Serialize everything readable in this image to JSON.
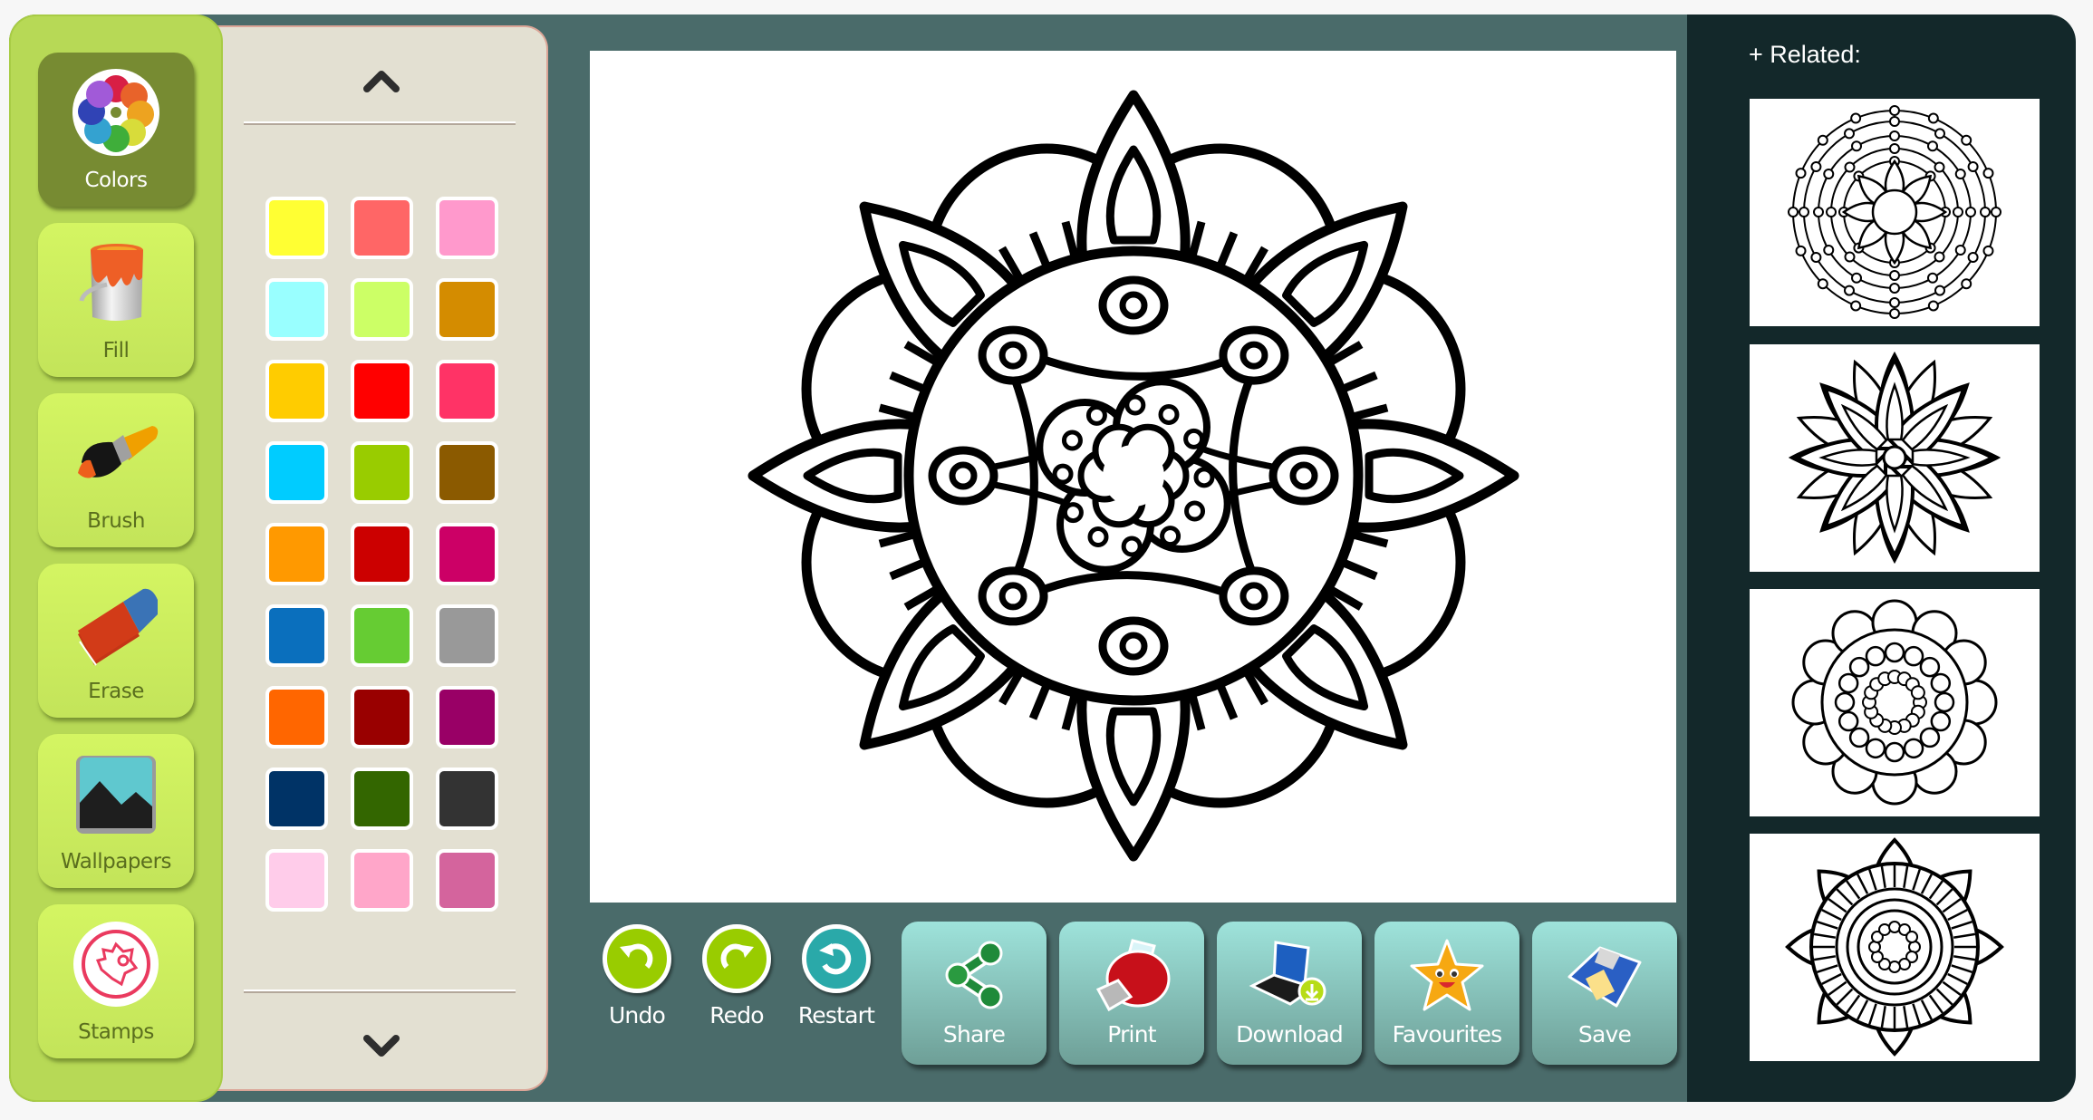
{
  "sidebar": {
    "tools": [
      {
        "id": "colors",
        "label": "Colors",
        "icon": "color-palette-icon",
        "active": true
      },
      {
        "id": "fill",
        "label": "Fill",
        "icon": "paint-bucket-icon",
        "active": false
      },
      {
        "id": "brush",
        "label": "Brush",
        "icon": "brush-icon",
        "active": false
      },
      {
        "id": "erase",
        "label": "Erase",
        "icon": "eraser-icon",
        "active": false
      },
      {
        "id": "wallpapers",
        "label": "Wallpapers",
        "icon": "wallpaper-icon",
        "active": false
      },
      {
        "id": "stamps",
        "label": "Stamps",
        "icon": "stamp-icon",
        "active": false
      }
    ]
  },
  "palette": {
    "scroll_up_icon": "chevron-up-icon",
    "scroll_down_icon": "chevron-down-icon",
    "colors": [
      [
        "#ffff33",
        "#ff6666",
        "#ff99cc"
      ],
      [
        "#99ffff",
        "#ccff66",
        "#d48c00"
      ],
      [
        "#ffcc00",
        "#ff0000",
        "#ff3366"
      ],
      [
        "#00ccff",
        "#99cc00",
        "#8b5a00"
      ],
      [
        "#ff9900",
        "#cc0000",
        "#cc0066"
      ],
      [
        "#0a6fbd",
        "#66cc33",
        "#999999"
      ],
      [
        "#ff6600",
        "#990000",
        "#990066"
      ],
      [
        "#003366",
        "#336600",
        "#333333"
      ],
      [
        "#ffccea",
        "#ffa6c9",
        "#d4649d"
      ]
    ]
  },
  "canvas": {
    "image": "mandala-coloring-page"
  },
  "toolbar": {
    "history": [
      {
        "id": "undo",
        "label": "Undo",
        "icon": "undo-icon",
        "color": "#99cc00"
      },
      {
        "id": "redo",
        "label": "Redo",
        "icon": "redo-icon",
        "color": "#99cc00"
      },
      {
        "id": "restart",
        "label": "Restart",
        "icon": "restart-icon",
        "color": "#2aa9a9"
      }
    ],
    "actions": [
      {
        "id": "share",
        "label": "Share",
        "icon": "share-icon"
      },
      {
        "id": "print",
        "label": "Print",
        "icon": "printer-icon"
      },
      {
        "id": "download",
        "label": "Download",
        "icon": "download-icon"
      },
      {
        "id": "favourites",
        "label": "Favourites",
        "icon": "star-icon"
      },
      {
        "id": "save",
        "label": "Save",
        "icon": "floppy-disk-icon"
      }
    ]
  },
  "related": {
    "title": "+ Related:",
    "thumbnails": [
      {
        "name": "mandala-rings-dots"
      },
      {
        "name": "mandala-star-petals"
      },
      {
        "name": "mandala-lace"
      },
      {
        "name": "mandala-sun-rays"
      }
    ]
  }
}
